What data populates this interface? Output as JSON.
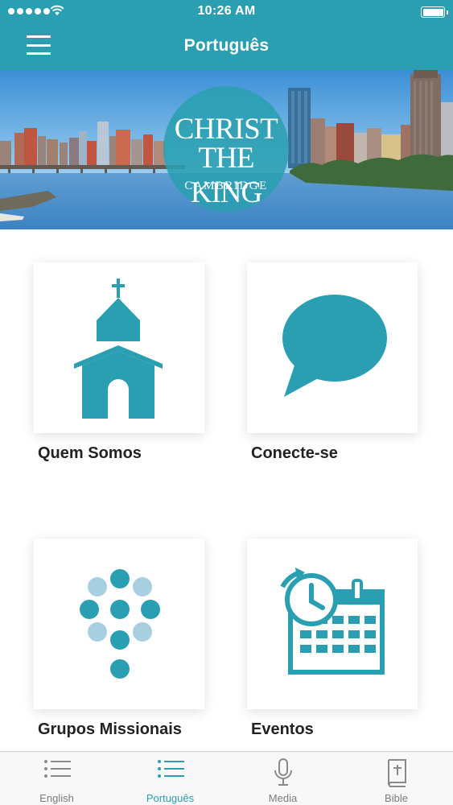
{
  "status_bar": {
    "time": "10:26 AM"
  },
  "nav": {
    "title": "Português",
    "menu_icon": "hamburger-icon"
  },
  "banner": {
    "logo": {
      "line1": "CHRIST",
      "line2": "THE KING",
      "line3": "CAMBRIDGE"
    }
  },
  "tiles": [
    {
      "label": "Quem Somos",
      "icon": "church-icon"
    },
    {
      "label": "Conecte-se",
      "icon": "speech-bubble-icon"
    },
    {
      "label": "Grupos Missionais",
      "icon": "grape-cluster-icon"
    },
    {
      "label": "Eventos",
      "icon": "calendar-clock-icon"
    }
  ],
  "tabs": [
    {
      "label": "English",
      "icon": "list-icon",
      "active": false
    },
    {
      "label": "Português",
      "icon": "list-icon",
      "active": true
    },
    {
      "label": "Media",
      "icon": "microphone-icon",
      "active": false
    },
    {
      "label": "Bible",
      "icon": "bible-icon",
      "active": false
    }
  ],
  "colors": {
    "accent": "#2a9fb1",
    "tab_inactive": "#7b7b7b",
    "tile_label": "#222222"
  }
}
